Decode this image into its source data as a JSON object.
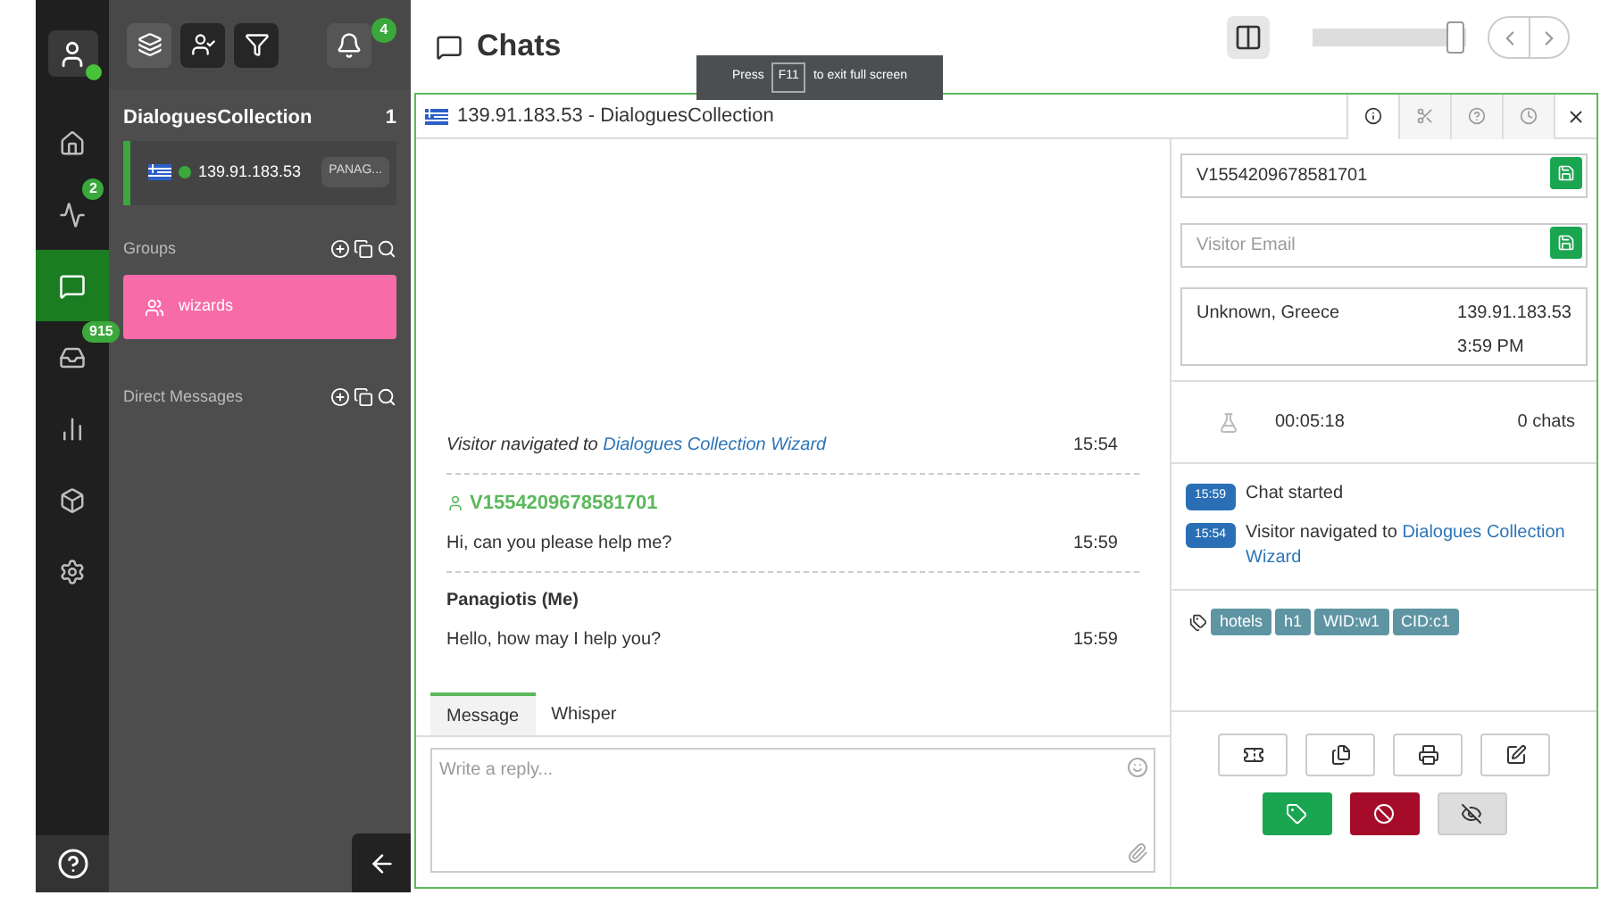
{
  "nav_rail": {
    "items": [
      {
        "selected": false
      },
      {
        "selected": false,
        "badge": "2"
      },
      {
        "selected": true
      },
      {
        "selected": false,
        "badge": "915"
      },
      {
        "selected": false
      },
      {
        "selected": false
      },
      {
        "selected": false
      }
    ],
    "online": true
  },
  "panel": {
    "toolbar": [
      {
        "selected": false
      },
      {
        "selected": true
      },
      {
        "selected": true
      }
    ],
    "notifications": "4",
    "collection": {
      "title": "DialoguesCollection",
      "count": "1",
      "chat": {
        "ip": "139.91.183.53",
        "agent": "PANAG...",
        "online": true
      }
    },
    "groups": {
      "title": "Groups",
      "items": [
        {
          "name": "wizards",
          "color": "#f76ca8"
        }
      ]
    },
    "direct_messages": {
      "title": "Direct Messages"
    }
  },
  "header": {
    "title": "Chats",
    "slider": {
      "level": 0.93
    }
  },
  "fullscreen_hint": {
    "before": "Press",
    "key": "F11",
    "after": "to exit full screen"
  },
  "chat_window": {
    "title": "139.91.183.53 - DialoguesCollection",
    "tabs": [
      {
        "selected": true
      },
      {
        "selected": false
      },
      {
        "selected": false
      },
      {
        "selected": false
      }
    ],
    "messages": [
      {
        "kind": "event",
        "text": "Visitor navigated to",
        "link": "Dialogues Collection Wizard",
        "time": "15:54"
      },
      {
        "kind": "visitor",
        "author": "V1554209678581701",
        "text": "Hi, can you please help me?",
        "time": "15:59"
      },
      {
        "kind": "agent",
        "author": "Panagiotis (Me)",
        "text": "Hello, how may I help you?",
        "time": "15:59"
      }
    ],
    "composer_tabs": [
      {
        "label": "Message",
        "selected": true
      },
      {
        "label": "Whisper",
        "selected": false
      }
    ],
    "reply": {
      "placeholder": "Write a reply..."
    }
  },
  "visitor": {
    "name": "V1554209678581701",
    "email": {
      "placeholder": "Visitor Email"
    },
    "location": "Unknown, Greece",
    "ip": "139.91.183.53",
    "local_time": "3:59 PM",
    "duration": "00:05:18",
    "chats": "0 chats",
    "timeline": [
      {
        "time": "15:59",
        "text": "Chat started"
      },
      {
        "time": "15:54",
        "text": "Visitor navigated to",
        "link": "Dialogues Collection Wizard"
      }
    ],
    "tags": [
      "hotels",
      "h1",
      "WID:w1",
      "CID:c1"
    ]
  }
}
